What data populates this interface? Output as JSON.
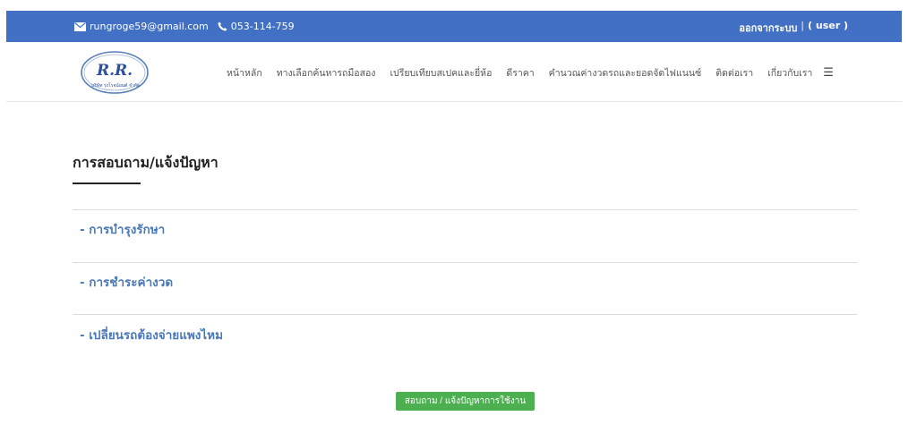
{
  "topbar": {
    "email": "rungroge59@gmail.com",
    "phone": "053-114-759",
    "logout_label": "ออกจากระบบ",
    "separator": "|",
    "user_label": "( user )",
    "email_icon": "mail-icon",
    "phone_icon": "phone-icon"
  },
  "logo": {
    "text": "R.R.",
    "subtext": "บริษัท รุ่งโรจน์ยนต์ จำกัด"
  },
  "nav": {
    "items": [
      "หน้าหลัก",
      "ทางเลือกค้นหารถมือสอง",
      "เปรียบเทียบสเปคและยี่ห้อ",
      "ดีราคา",
      "คำนวณค่างวดรถและยอดจัดไฟแนนซ์",
      "ติดต่อเรา",
      "เกี่ยวกับเรา"
    ],
    "menu_icon": "hamburger-menu-icon"
  },
  "main": {
    "title": "การสอบถาม/แจ้งปัญหา",
    "faqs": [
      "- การบำรุงรักษา",
      "- การชำระค่างวด",
      "- เปลี่ยนรถต้องจ่ายแพงไหม"
    ],
    "button_label": "สอบถาม / แจ้งปัญหาการใช้งาน"
  },
  "colors": {
    "topbar": "#4170c4",
    "link": "#4a78b8",
    "button": "#4caf50"
  }
}
